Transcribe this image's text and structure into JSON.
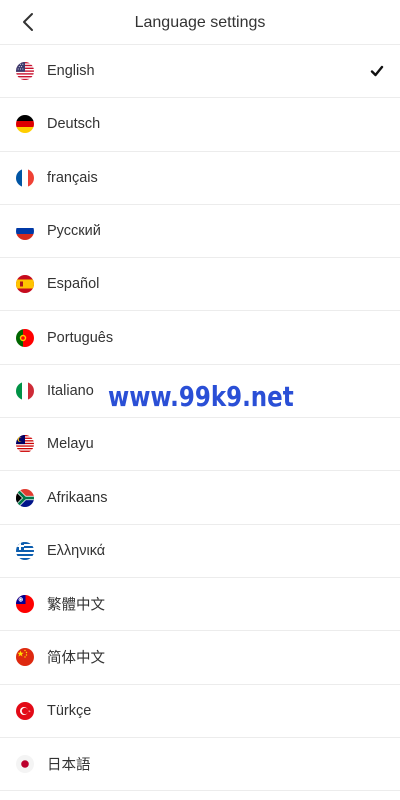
{
  "header": {
    "title": "Language settings",
    "back_icon": "chevron-left-icon"
  },
  "languages": [
    {
      "code": "en",
      "label": "English",
      "flag": "us-flag-icon",
      "selected": true
    },
    {
      "code": "de",
      "label": "Deutsch",
      "flag": "germany-flag-icon",
      "selected": false
    },
    {
      "code": "fr",
      "label": "français",
      "flag": "france-flag-icon",
      "selected": false
    },
    {
      "code": "ru",
      "label": "Русский",
      "flag": "russia-flag-icon",
      "selected": false
    },
    {
      "code": "es",
      "label": "Español",
      "flag": "spain-flag-icon",
      "selected": false
    },
    {
      "code": "pt",
      "label": "Português",
      "flag": "portugal-flag-icon",
      "selected": false
    },
    {
      "code": "it",
      "label": "Italiano",
      "flag": "italy-flag-icon",
      "selected": false
    },
    {
      "code": "ms",
      "label": "Melayu",
      "flag": "malaysia-flag-icon",
      "selected": false
    },
    {
      "code": "af",
      "label": "Afrikaans",
      "flag": "south-africa-flag-icon",
      "selected": false
    },
    {
      "code": "el",
      "label": "Ελληνικά",
      "flag": "greece-flag-icon",
      "selected": false
    },
    {
      "code": "zh-tw",
      "label": "繁體中文",
      "flag": "taiwan-flag-icon",
      "selected": false
    },
    {
      "code": "zh-cn",
      "label": "简体中文",
      "flag": "china-flag-icon",
      "selected": false
    },
    {
      "code": "tr",
      "label": "Türkçe",
      "flag": "turkey-flag-icon",
      "selected": false
    },
    {
      "code": "ja",
      "label": "日本語",
      "flag": "japan-flag-icon",
      "selected": false
    }
  ],
  "selected_icon": "checkmark-icon",
  "watermark": "www.99k9.net",
  "colors": {
    "accent_watermark": "#2a4fd6",
    "divider": "#ececec",
    "text": "#333333"
  }
}
